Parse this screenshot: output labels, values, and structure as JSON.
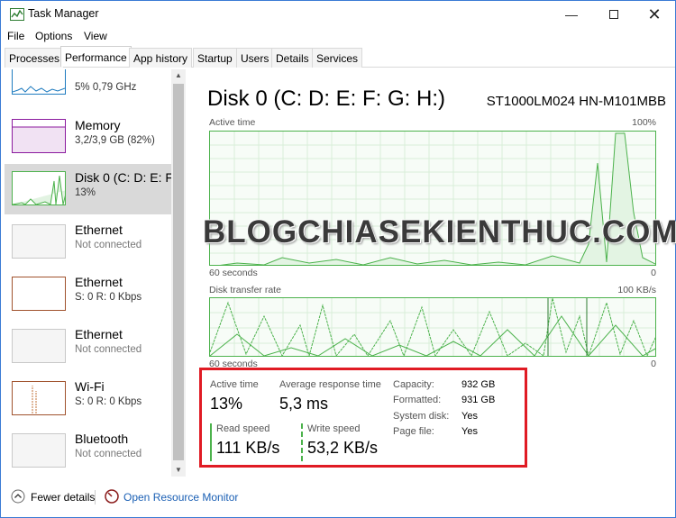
{
  "window": {
    "title": "Task Manager"
  },
  "menu": {
    "file": "File",
    "options": "Options",
    "view": "View"
  },
  "tabs": [
    {
      "label": "Processes"
    },
    {
      "label": "Performance"
    },
    {
      "label": "App history"
    },
    {
      "label": "Startup"
    },
    {
      "label": "Users"
    },
    {
      "label": "Details"
    },
    {
      "label": "Services"
    }
  ],
  "sidebar": {
    "items": [
      {
        "name": "",
        "sub": "5% 0,79 GHz"
      },
      {
        "name": "Memory",
        "sub": "3,2/3,9 GB (82%)"
      },
      {
        "name": "Disk 0 (C: D: E: F",
        "sub": "13%"
      },
      {
        "name": "Ethernet",
        "sub": "Not connected"
      },
      {
        "name": "Ethernet",
        "sub": "S: 0 R: 0 Kbps"
      },
      {
        "name": "Ethernet",
        "sub": "Not connected"
      },
      {
        "name": "Wi-Fi",
        "sub": "S: 0 R: 0 Kbps"
      },
      {
        "name": "Bluetooth",
        "sub": "Not connected"
      }
    ]
  },
  "main": {
    "title": "Disk 0 (C: D: E: F: G: H:)",
    "model": "ST1000LM024 HN-M101MBB",
    "active_chart": {
      "label": "Active time",
      "max": "100%",
      "time_label": "60 seconds",
      "min": "0"
    },
    "transfer_chart": {
      "label": "Disk transfer rate",
      "max": "100 KB/s",
      "time_label": "60 seconds",
      "min": "0"
    },
    "stats": {
      "active_time_label": "Active time",
      "active_time_value": "13%",
      "avg_response_label": "Average response time",
      "avg_response_value": "5,3 ms",
      "read_speed_label": "Read speed",
      "read_speed_value": "111 KB/s",
      "write_speed_label": "Write speed",
      "write_speed_value": "53,2 KB/s",
      "capacity_label": "Capacity:",
      "capacity_value": "932 GB",
      "formatted_label": "Formatted:",
      "formatted_value": "931 GB",
      "system_disk_label": "System disk:",
      "system_disk_value": "Yes",
      "page_file_label": "Page file:",
      "page_file_value": "Yes"
    }
  },
  "watermark": "BLOGCHIASEKIENTHUC.COM",
  "footer": {
    "fewer_details": "Fewer details",
    "open_resource_monitor": "Open Resource Monitor"
  },
  "colors": {
    "disk_green": "#4cb24c",
    "memory_purple": "#8b1a9e",
    "ethernet_orange": "#a0522d",
    "highlight_red": "#e01b24",
    "link_blue": "#1a5fb4"
  },
  "icons": {
    "app": "task-manager-icon",
    "minimize": "minimize-icon",
    "maximize": "maximize-icon",
    "close": "close-icon",
    "fewer_details": "chevron-up-circle-icon",
    "resource_monitor": "resource-monitor-icon"
  }
}
